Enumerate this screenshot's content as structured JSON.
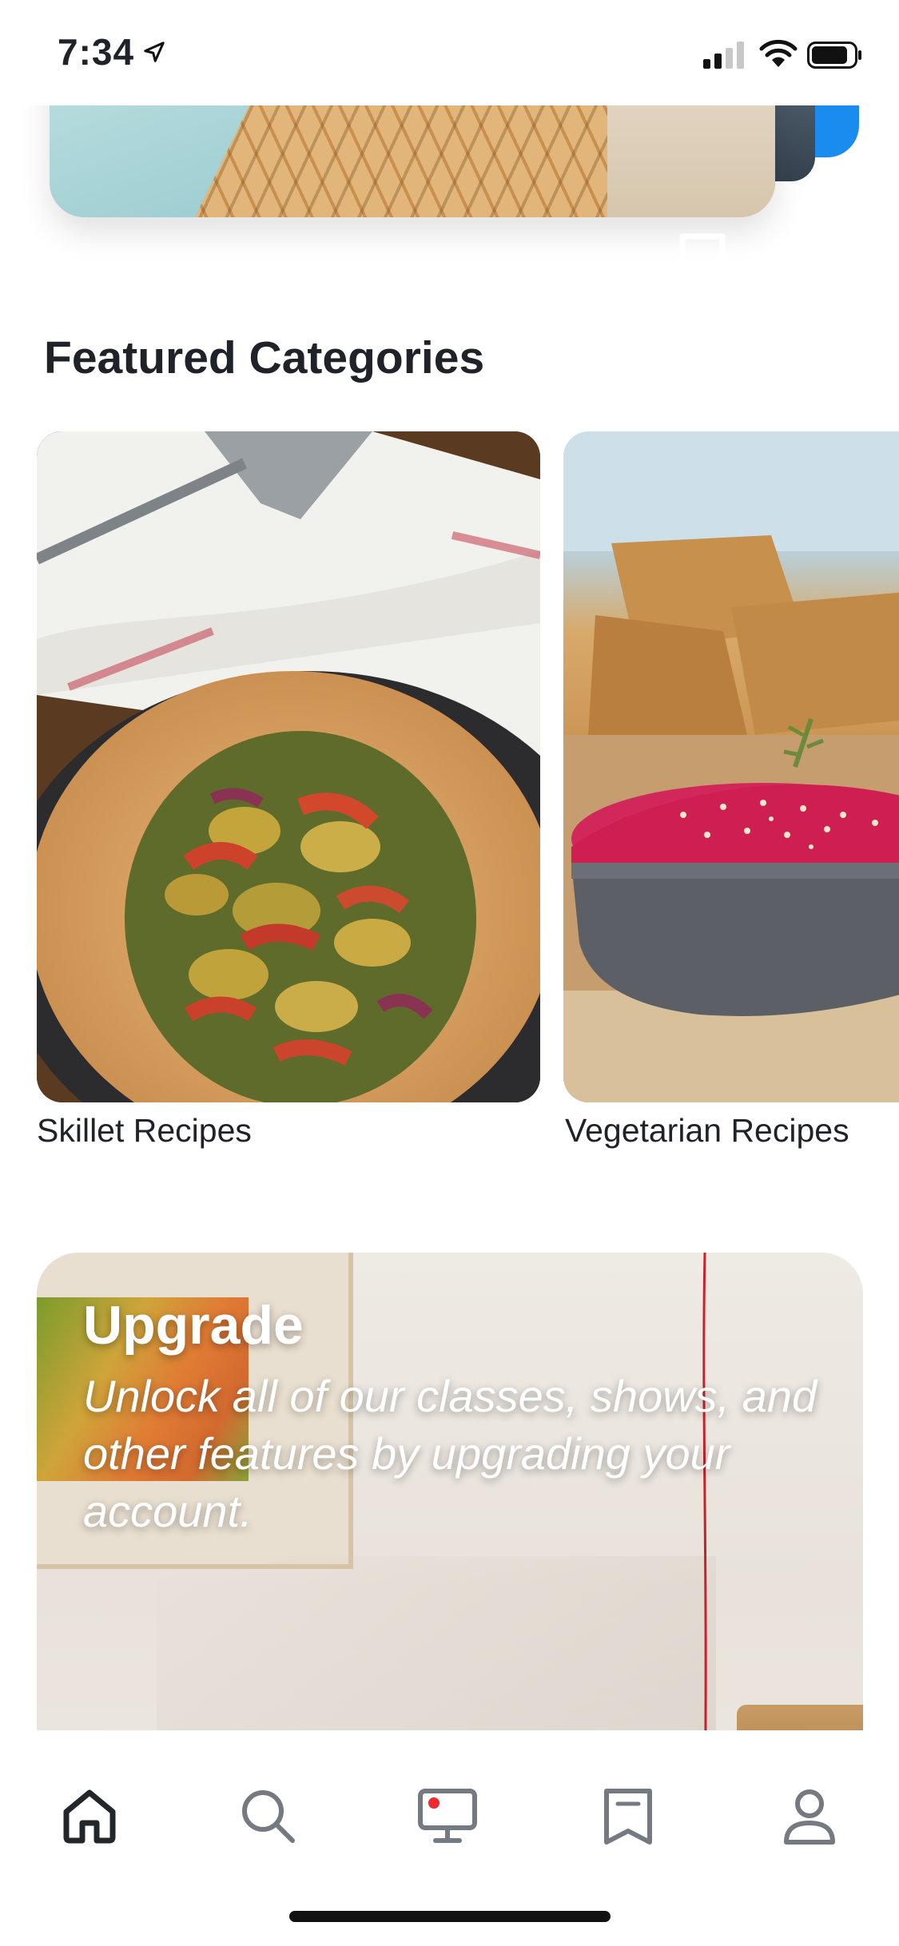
{
  "status_bar": {
    "time": "7:34"
  },
  "featured": {
    "title": "Featured Categories",
    "categories": [
      {
        "label": "Skillet Recipes"
      },
      {
        "label": "Vegetarian Recipes"
      }
    ]
  },
  "upgrade": {
    "title": "Upgrade",
    "description": "Unlock all of our classes, shows, and other features by upgrading your account."
  },
  "tab_bar": {
    "items": [
      {
        "icon": "home-icon",
        "active": true
      },
      {
        "icon": "search-icon",
        "active": false
      },
      {
        "icon": "live-tv-icon",
        "active": false
      },
      {
        "icon": "saved-icon",
        "active": false
      },
      {
        "icon": "profile-icon",
        "active": false
      }
    ]
  },
  "colors": {
    "text": "#1f2329",
    "tab_icon": "#757a80",
    "live_dot": "#ef2b2d",
    "accent_blue": "#1a8cf0"
  }
}
